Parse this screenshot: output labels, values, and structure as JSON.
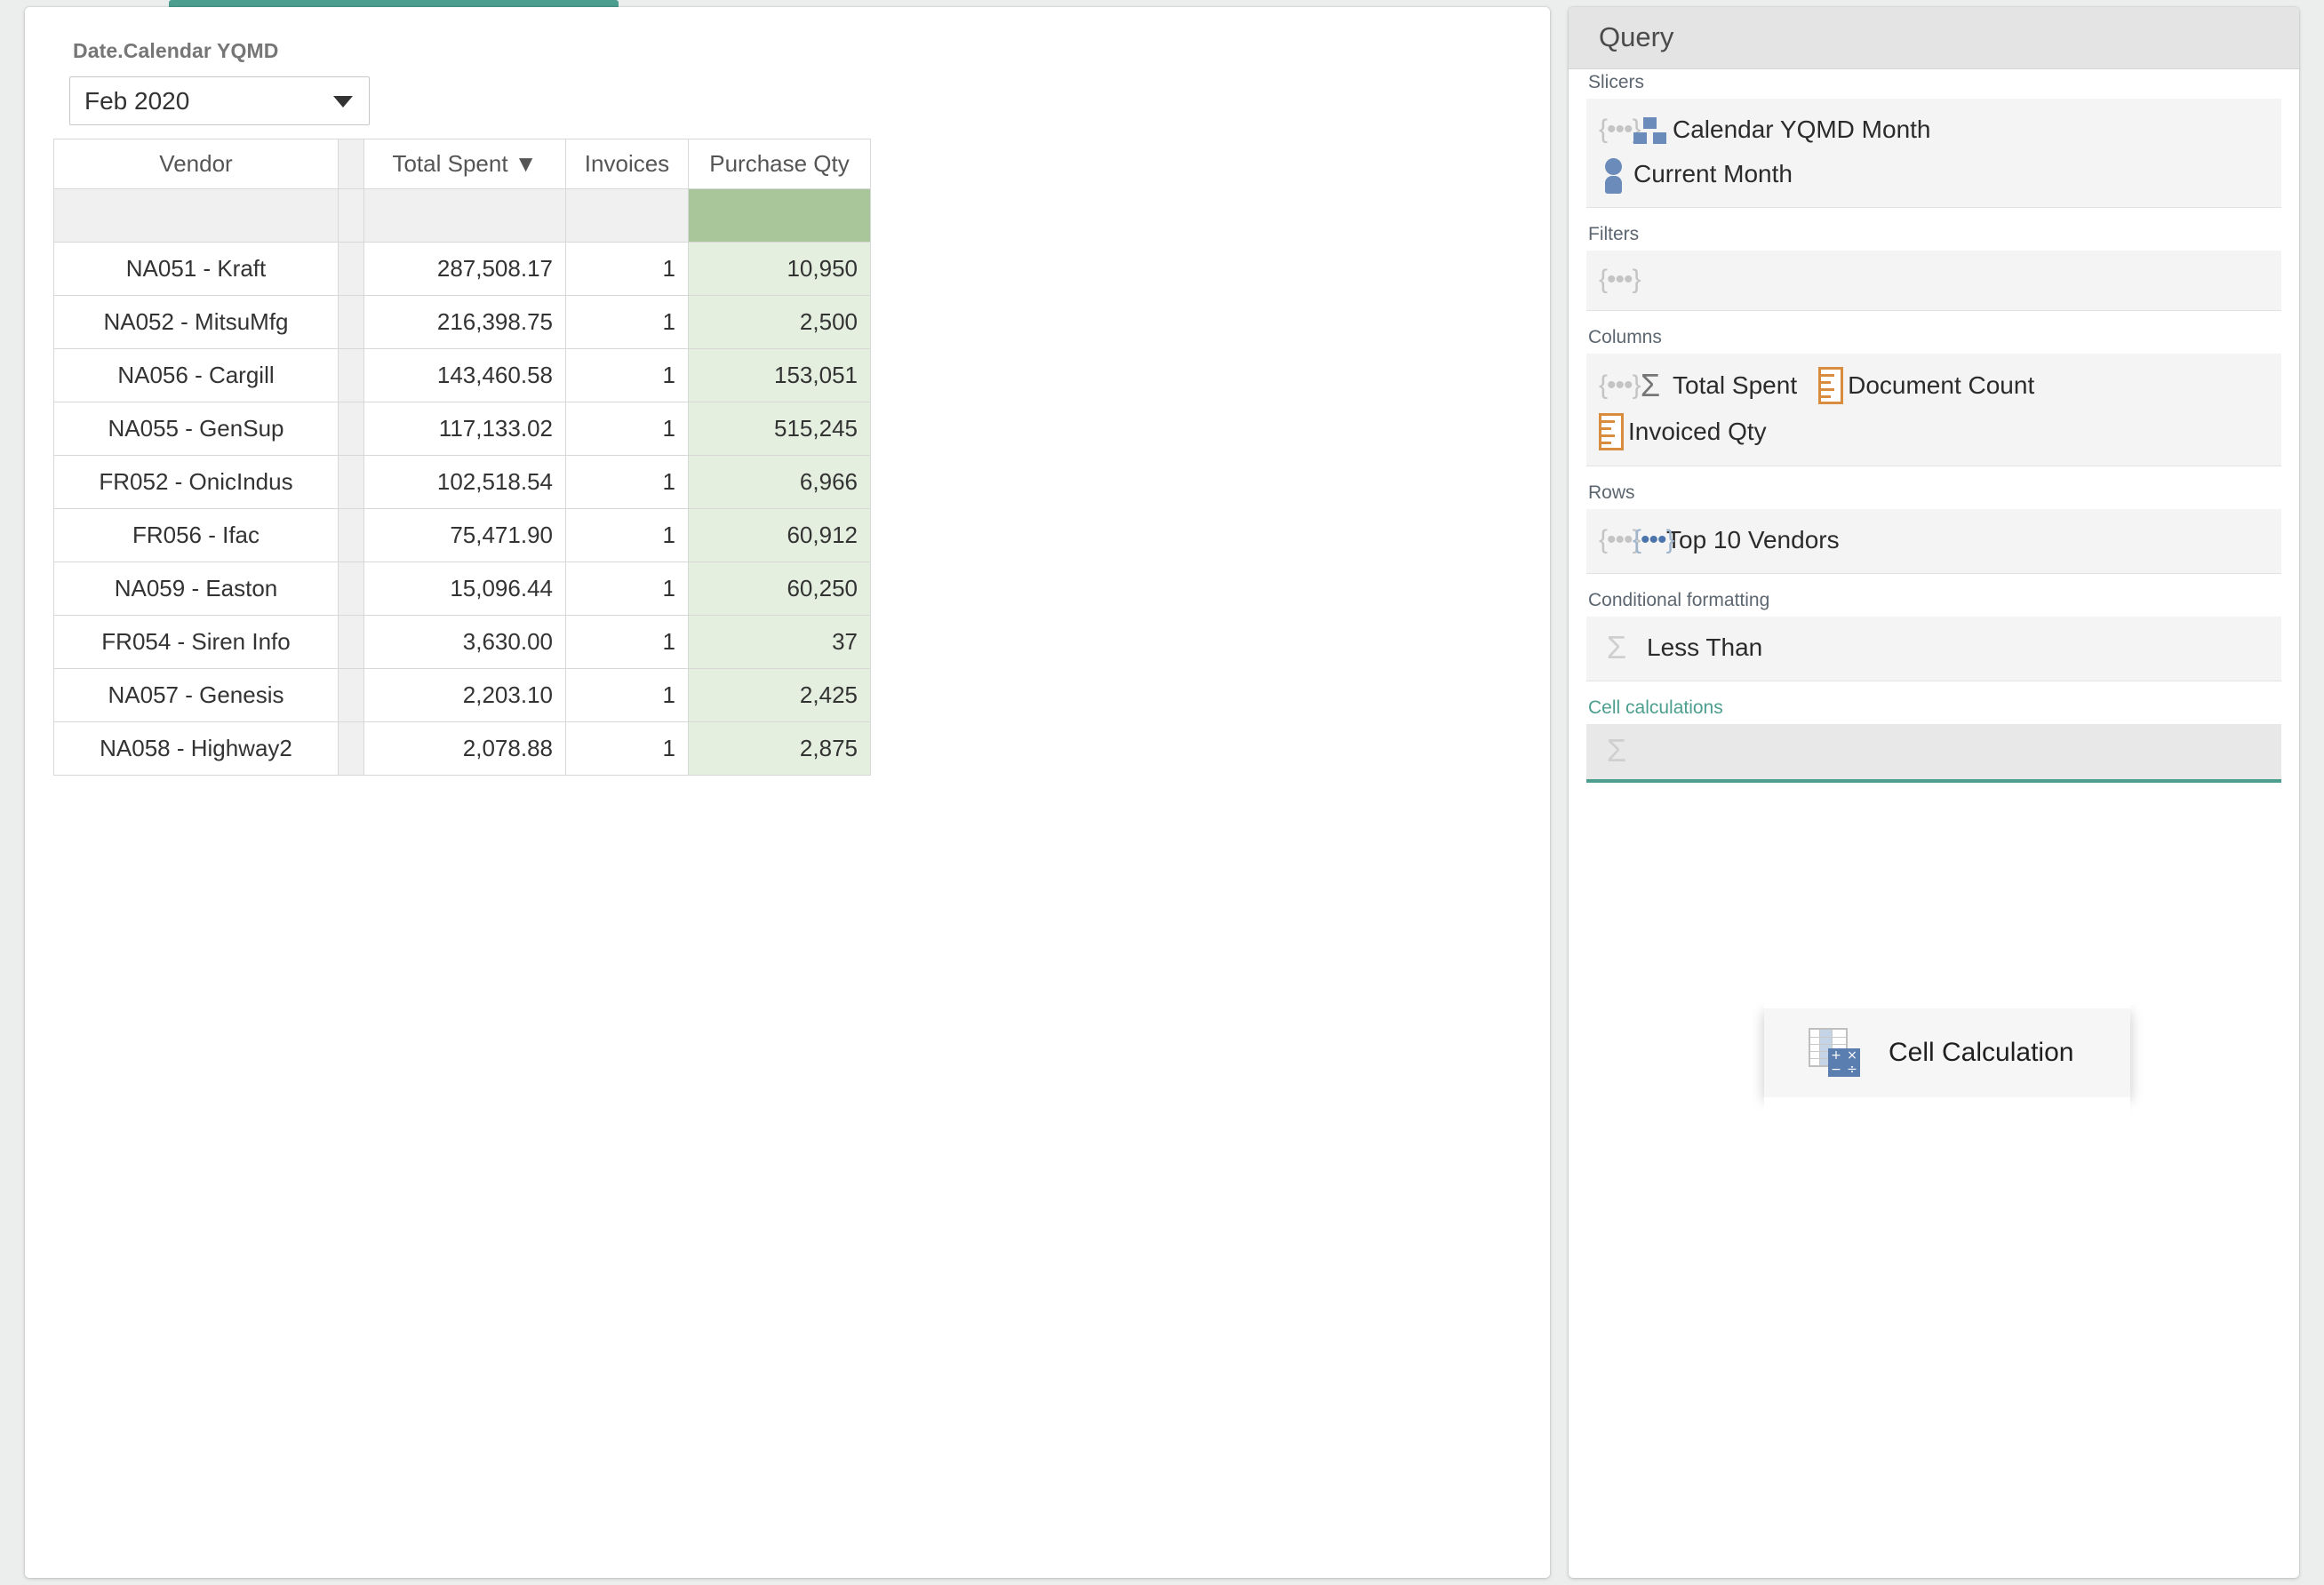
{
  "theme": {
    "accent_teal": "#4c9e8f",
    "header_underline_navy": "#1f3c5e",
    "total_green": "#a8c69a",
    "cell_green": "#e4efe0",
    "flag_red": "#d4534a",
    "measure_orange": "#d98b3e",
    "hierarchy_blue": "#6b8cba"
  },
  "report": {
    "slicer": {
      "label": "Date.Calendar YQMD",
      "selected_value": "Feb 2020"
    },
    "table": {
      "columns": [
        "Vendor",
        "Total Spent ▼",
        "Invoices",
        "Purchase Qty"
      ],
      "rows": [
        {
          "vendor": "NA051 - Kraft",
          "total_spent": "287,508.17",
          "invoices": "1",
          "purchase_qty": "10,950",
          "qty_flagged": false
        },
        {
          "vendor": "NA052 - MitsuMfg",
          "total_spent": "216,398.75",
          "invoices": "1",
          "purchase_qty": "2,500",
          "qty_flagged": true
        },
        {
          "vendor": "NA056 - Cargill",
          "total_spent": "143,460.58",
          "invoices": "1",
          "purchase_qty": "153,051",
          "qty_flagged": false
        },
        {
          "vendor": "NA055 - GenSup",
          "total_spent": "117,133.02",
          "invoices": "1",
          "purchase_qty": "515,245",
          "qty_flagged": false
        },
        {
          "vendor": "FR052 - OnicIndus",
          "total_spent": "102,518.54",
          "invoices": "1",
          "purchase_qty": "6,966",
          "qty_flagged": true
        },
        {
          "vendor": "FR056 - Ifac",
          "total_spent": "75,471.90",
          "invoices": "1",
          "purchase_qty": "60,912",
          "qty_flagged": false
        },
        {
          "vendor": "NA059 - Easton",
          "total_spent": "15,096.44",
          "invoices": "1",
          "purchase_qty": "60,250",
          "qty_flagged": false
        },
        {
          "vendor": "FR054 - Siren Info",
          "total_spent": "3,630.00",
          "invoices": "1",
          "purchase_qty": "37",
          "qty_flagged": true
        },
        {
          "vendor": "NA057 - Genesis",
          "total_spent": "2,203.10",
          "invoices": "1",
          "purchase_qty": "2,425",
          "qty_flagged": true
        },
        {
          "vendor": "NA058 - Highway2",
          "total_spent": "2,078.88",
          "invoices": "1",
          "purchase_qty": "2,875",
          "qty_flagged": true
        }
      ]
    }
  },
  "query_panel": {
    "title": "Query",
    "sections": {
      "slicers": {
        "title": "Slicers",
        "items": [
          {
            "label": "Calendar YQMD Month",
            "icons": [
              "braces-set-icon",
              "hierarchy-icon"
            ]
          },
          {
            "label": "Current Month",
            "icons": [
              "member-person-icon"
            ]
          }
        ]
      },
      "filters": {
        "title": "Filters",
        "items": []
      },
      "columns": {
        "title": "Columns",
        "items": [
          {
            "label": "Total Spent",
            "icons": [
              "braces-set-icon",
              "sigma-icon"
            ]
          },
          {
            "label": "Document Count",
            "icons": [
              "measure-icon"
            ]
          },
          {
            "label": "Invoiced Qty",
            "icons": [
              "measure-icon"
            ]
          }
        ]
      },
      "rows": {
        "title": "Rows",
        "items": [
          {
            "label": "Top 10 Vendors",
            "icons": [
              "braces-set-icon",
              "braces-set-icon-blue"
            ]
          }
        ]
      },
      "conditional_formatting": {
        "title": "Conditional formatting",
        "items": [
          {
            "label": "Less Than",
            "icons": [
              "sigma-icon-light"
            ]
          }
        ]
      },
      "cell_calculations": {
        "title": "Cell calculations",
        "items": [],
        "drop_active": true
      }
    }
  },
  "drag_ghost": {
    "label": "Cell Calculation",
    "icon": "cell-calculation-icon",
    "calc_symbols": [
      "+",
      "×",
      "−",
      "÷"
    ]
  }
}
